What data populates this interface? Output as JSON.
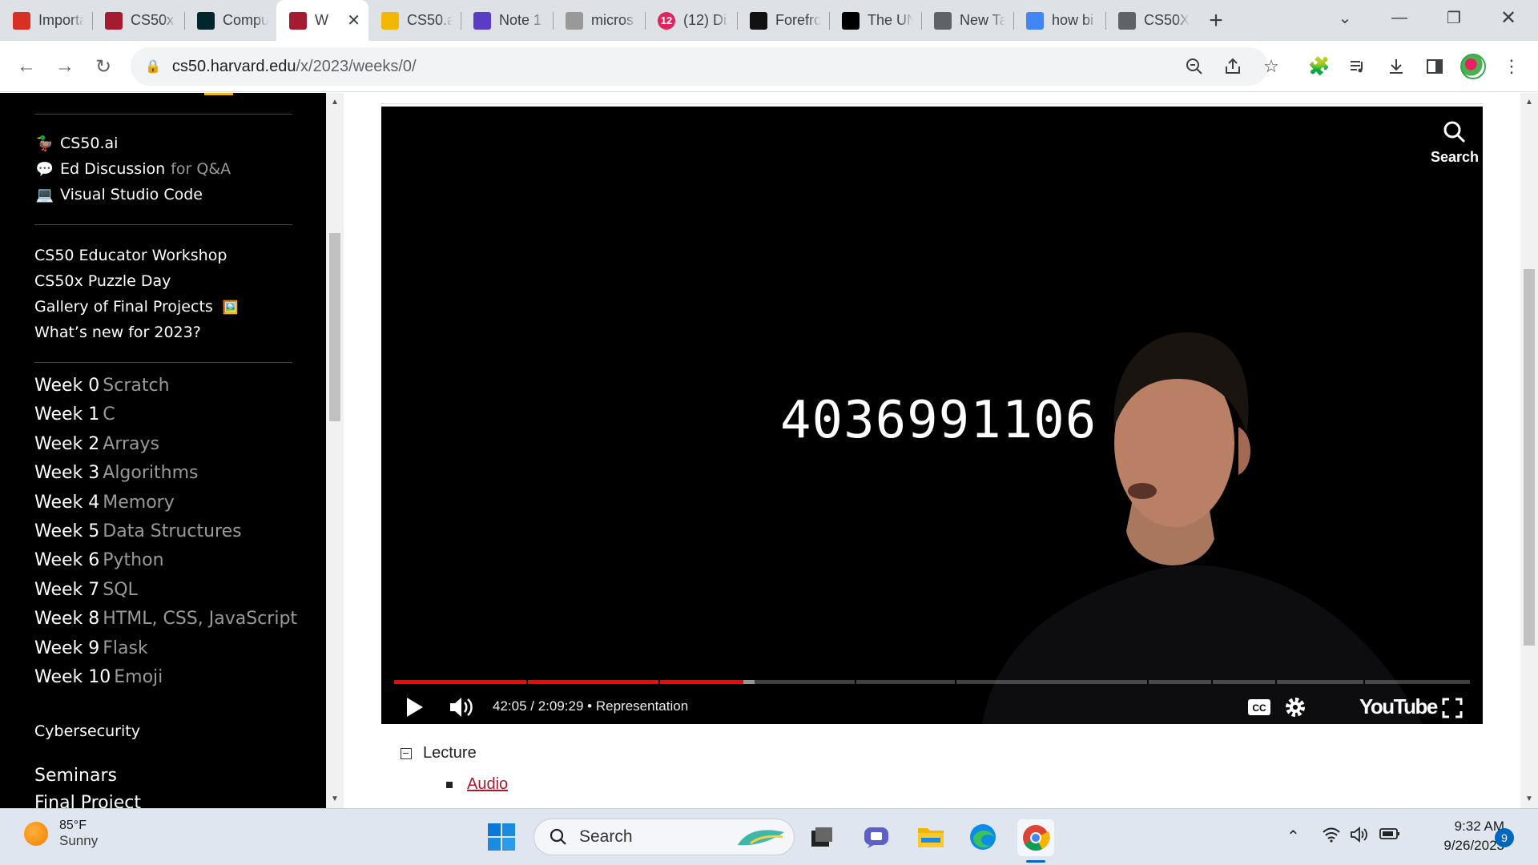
{
  "tabs": [
    {
      "label": "Importa",
      "icon": "gmail-icon",
      "color": "#d93025"
    },
    {
      "label": "CS50x",
      "icon": "harvard-shield-icon",
      "color": "#a51c30"
    },
    {
      "label": "Compu",
      "icon": "edx-icon",
      "color": "#02262b"
    },
    {
      "label": "W",
      "icon": "harvard-shield-icon",
      "color": "#a51c30",
      "active": true
    },
    {
      "label": "CS50.a",
      "icon": "duck-icon",
      "color": "#f2b705"
    },
    {
      "label": "Note 1",
      "icon": "note-icon",
      "color": "#5b3cc4"
    },
    {
      "label": "micros",
      "icon": "search-results-icon",
      "color": "#999999"
    },
    {
      "label": "(12) Di",
      "icon": "notification-icon",
      "color": "#e0245e",
      "badge": "12"
    },
    {
      "label": "Forefro",
      "icon": "forefront-icon",
      "color": "#111111"
    },
    {
      "label": "The UN",
      "icon": "ud-icon",
      "color": "#000000"
    },
    {
      "label": "New Ta",
      "icon": "chrome-icon",
      "color": "#5f6368"
    },
    {
      "label": "how bi",
      "icon": "google-icon",
      "color": "#4285f4"
    },
    {
      "label": "CS50X",
      "icon": "globe-icon",
      "color": "#5f6368"
    }
  ],
  "address": {
    "host": "cs50.harvard.edu",
    "path": "/x/2023/weeks/0/"
  },
  "sidebar": {
    "tools": [
      {
        "label": "CS50.ai",
        "icon": "duck-icon"
      },
      {
        "label": "Ed Discussion",
        "extra": "for Q&A",
        "icon": "chat-bubble-icon"
      },
      {
        "label": "Visual Studio Code",
        "icon": "laptop-icon"
      }
    ],
    "links": [
      "CS50 Educator Workshop",
      "CS50x Puzzle Day",
      "Gallery of Final Projects",
      "What’s new for 2023?"
    ],
    "weeks": [
      {
        "num": "Week 0",
        "topic": "Scratch"
      },
      {
        "num": "Week 1",
        "topic": "C"
      },
      {
        "num": "Week 2",
        "topic": "Arrays"
      },
      {
        "num": "Week 3",
        "topic": "Algorithms"
      },
      {
        "num": "Week 4",
        "topic": "Memory"
      },
      {
        "num": "Week 5",
        "topic": "Data Structures"
      },
      {
        "num": "Week 6",
        "topic": "Python"
      },
      {
        "num": "Week 7",
        "topic": "SQL"
      },
      {
        "num": "Week 8",
        "topic": "HTML, CSS, JavaScript"
      },
      {
        "num": "Week 9",
        "topic": "Flask"
      },
      {
        "num": "Week 10",
        "topic": "Emoji"
      }
    ],
    "cybersecurity": "Cybersecurity",
    "seminars": "Seminars",
    "final_project": "Final Project"
  },
  "video": {
    "number": "4036991106",
    "search_label": "Search",
    "current_time": "42:05",
    "duration": "2:09:29",
    "chapter": "Representation",
    "played_fraction": 0.325,
    "buffered_fraction": 0.335,
    "youtube_label": "YouTube"
  },
  "content": {
    "lecture_label": "Lecture",
    "audio_label": "Audio"
  },
  "taskbar": {
    "temp": "85°F",
    "condition": "Sunny",
    "search_placeholder": "Search",
    "time": "9:32 AM",
    "date": "9/26/2023",
    "notifications": "9"
  }
}
